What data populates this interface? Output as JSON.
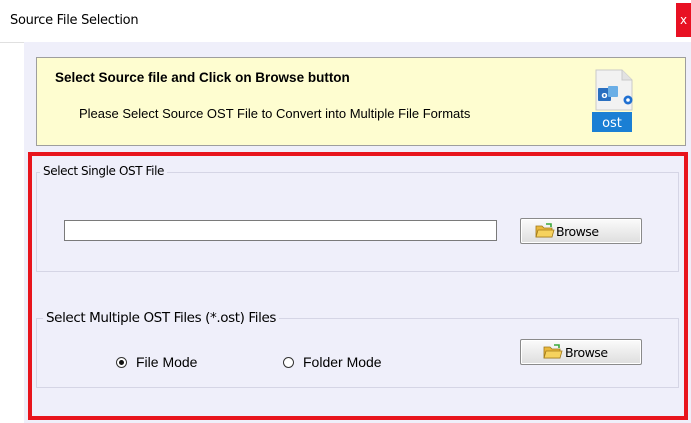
{
  "window": {
    "title": "Source File Selection",
    "close_glyph": "x"
  },
  "banner": {
    "title": "Select Source file and Click on Browse button",
    "subtitle": "Please Select Source OST File to Convert into Multiple File Formats",
    "icon_label": "ost",
    "icon": "ost-file-icon"
  },
  "single_group": {
    "legend": "Select Single OST File",
    "file_path_value": "",
    "browse_label": "Browse"
  },
  "multi_group": {
    "legend": "Select Multiple OST Files (*.ost) Files",
    "radio_file_mode": "File Mode",
    "radio_folder_mode": "Folder Mode",
    "selected_mode": "File Mode",
    "browse_label": "Browse"
  },
  "colors": {
    "banner_bg": "#fefdd0",
    "client_bg": "#efeffa",
    "highlight_frame": "#e8141c",
    "close_button": "#e81123"
  }
}
